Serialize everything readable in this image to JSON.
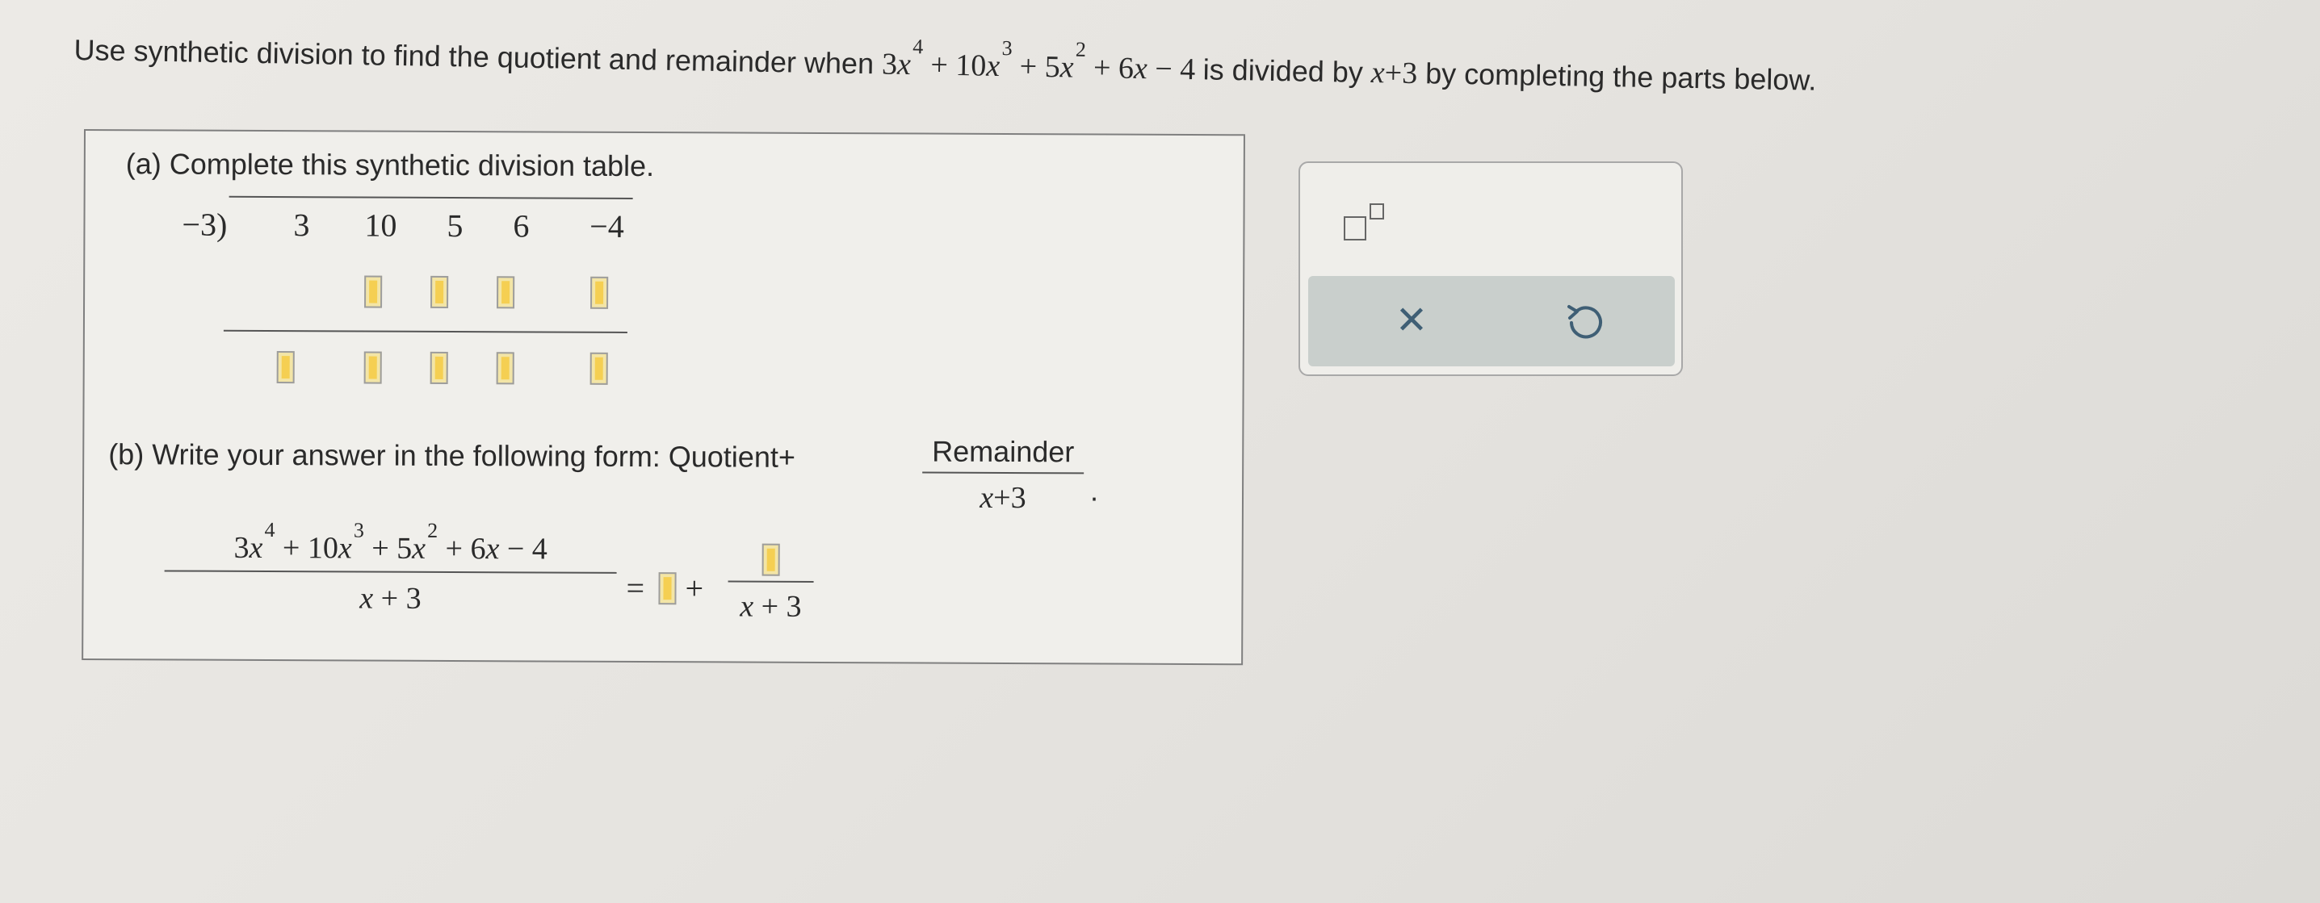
{
  "problem": {
    "prefix": "Use synthetic division to find the quotient and remainder when",
    "poly": {
      "c1": "3",
      "v": "x",
      "e1": "4",
      "op1": "+",
      "c2": "10",
      "e2": "3",
      "op2": "+",
      "c3": "5",
      "e3": "2",
      "op3": "+",
      "c4": "6",
      "op4": "−",
      "c5": "4"
    },
    "middle": "is divided by",
    "divisor": {
      "v": "x",
      "rest": "+3"
    },
    "suffix": "by completing the parts below."
  },
  "part_a": {
    "title": "(a) Complete this synthetic division table.",
    "divisor_label": "−3)",
    "coefficients": [
      "3",
      "10",
      "5",
      "6",
      "−4"
    ]
  },
  "part_b": {
    "instruction": "(b) Write your answer in the following form: Quotient+",
    "form_numerator": "Remainder",
    "form_den_var": "x",
    "form_den_rest": "+3",
    "form_period": ".",
    "lhs": {
      "c1": "3",
      "v": "x",
      "e1": "4",
      "t2": "+ 10",
      "e2": "3",
      "t3": "+ 5",
      "e3": "2",
      "t4": "+ 6",
      "t5": "− 4",
      "den_rest": "+ 3"
    },
    "eq": "=",
    "plus": "+",
    "rhs_den_rest": "+ 3"
  },
  "tool_panel": {
    "clear_symbol": "✕"
  },
  "colors": {
    "answer_box_fill": "#f5cf52",
    "answer_box_border": "#9d9d9d",
    "tool_bar": "#c9cfcc",
    "icon_blue": "#3f5f75"
  }
}
